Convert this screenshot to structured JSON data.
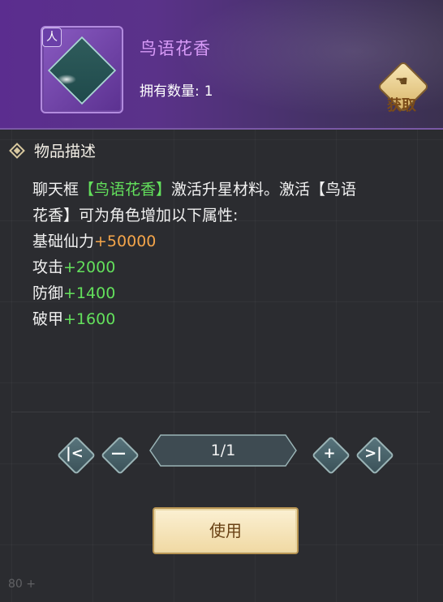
{
  "item": {
    "rarity": "人",
    "name": "鸟语花香",
    "owned_label": "拥有数量:",
    "owned_value": "1",
    "obtain_label": "获取"
  },
  "description": {
    "title": "物品描述",
    "line1_pre": "聊天框",
    "line1_item": "【鸟语花香】",
    "line1_post": "激活升星材料。激活【鸟语",
    "line2": "花香】可为角色增加以下属性:",
    "stats": [
      {
        "label": "基础仙力",
        "value": "+50000"
      },
      {
        "label": "攻击",
        "value": "+2000"
      },
      {
        "label": "防御",
        "value": "+1400"
      },
      {
        "label": "破甲",
        "value": "+1600"
      }
    ]
  },
  "pager": {
    "first_icon": "first-page-icon",
    "prev_icon": "minus-icon",
    "page_text": "1/1",
    "next_icon": "plus-icon",
    "last_icon": "last-page-icon"
  },
  "actions": {
    "use_label": "使用"
  },
  "background": {
    "bottom_text": "80 +"
  }
}
